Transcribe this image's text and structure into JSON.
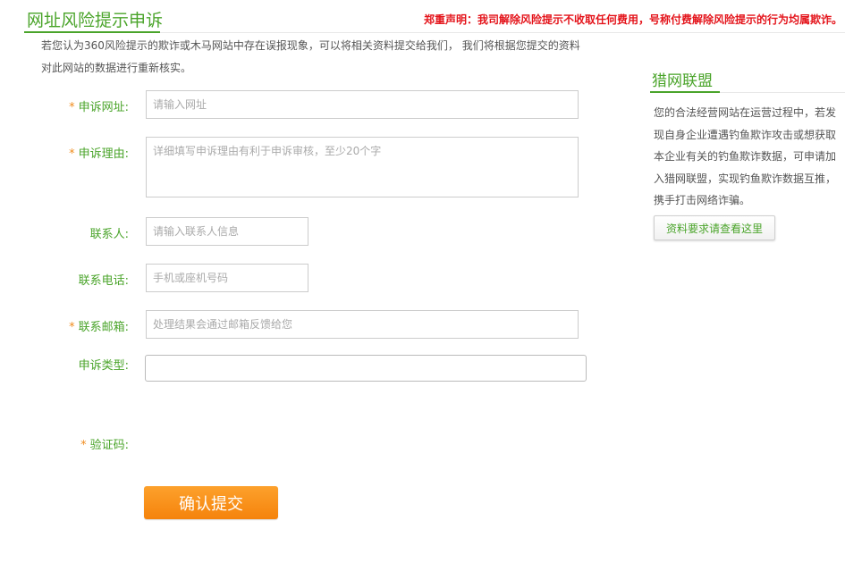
{
  "header": {
    "title": "网址风险提示申诉",
    "disclaimer": "郑重声明：我司解除风险提示不收取任何费用，号称付费解除风险提示的行为均属欺诈。",
    "intro_line1": "若您认为360风险提示的欺诈或木马网站中存在误报现象，可以将相关资料提交给我们， 我们将根据您提交的资料",
    "intro_line2": "对此网站的数据进行重新核实。"
  },
  "form": {
    "required_mark": "*",
    "url_label": "申诉网址:",
    "url_placeholder": "请输入网址",
    "reason_label": "申诉理由:",
    "reason_placeholder": "详细填写申诉理由有利于申诉审核，至少20个字",
    "contact_label": "联系人:",
    "contact_placeholder": "请输入联系人信息",
    "phone_label": "联系电话:",
    "phone_placeholder": "手机或座机号码",
    "email_label": "联系邮箱:",
    "email_placeholder": "处理结果会通过邮箱反馈给您",
    "type_label": "申诉类型:",
    "type_value": "",
    "captcha_label": "验证码:",
    "submit_label": "确认提交"
  },
  "sidebar": {
    "title": "猎网联盟",
    "text": "您的合法经营网站在运营过程中，若发现自身企业遭遇钓鱼欺诈攻击或想获取本企业有关的钓鱼欺诈数据，可申请加入猎网联盟，实现钓鱼欺诈数据互推，携手打击网络诈骗。",
    "button_label": "资料要求请查看这里"
  },
  "colors": {
    "accent_green": "#4aa42a",
    "required_orange": "#f08c1e",
    "warning_red": "#e4141b",
    "submit_orange": "#f5830c"
  }
}
